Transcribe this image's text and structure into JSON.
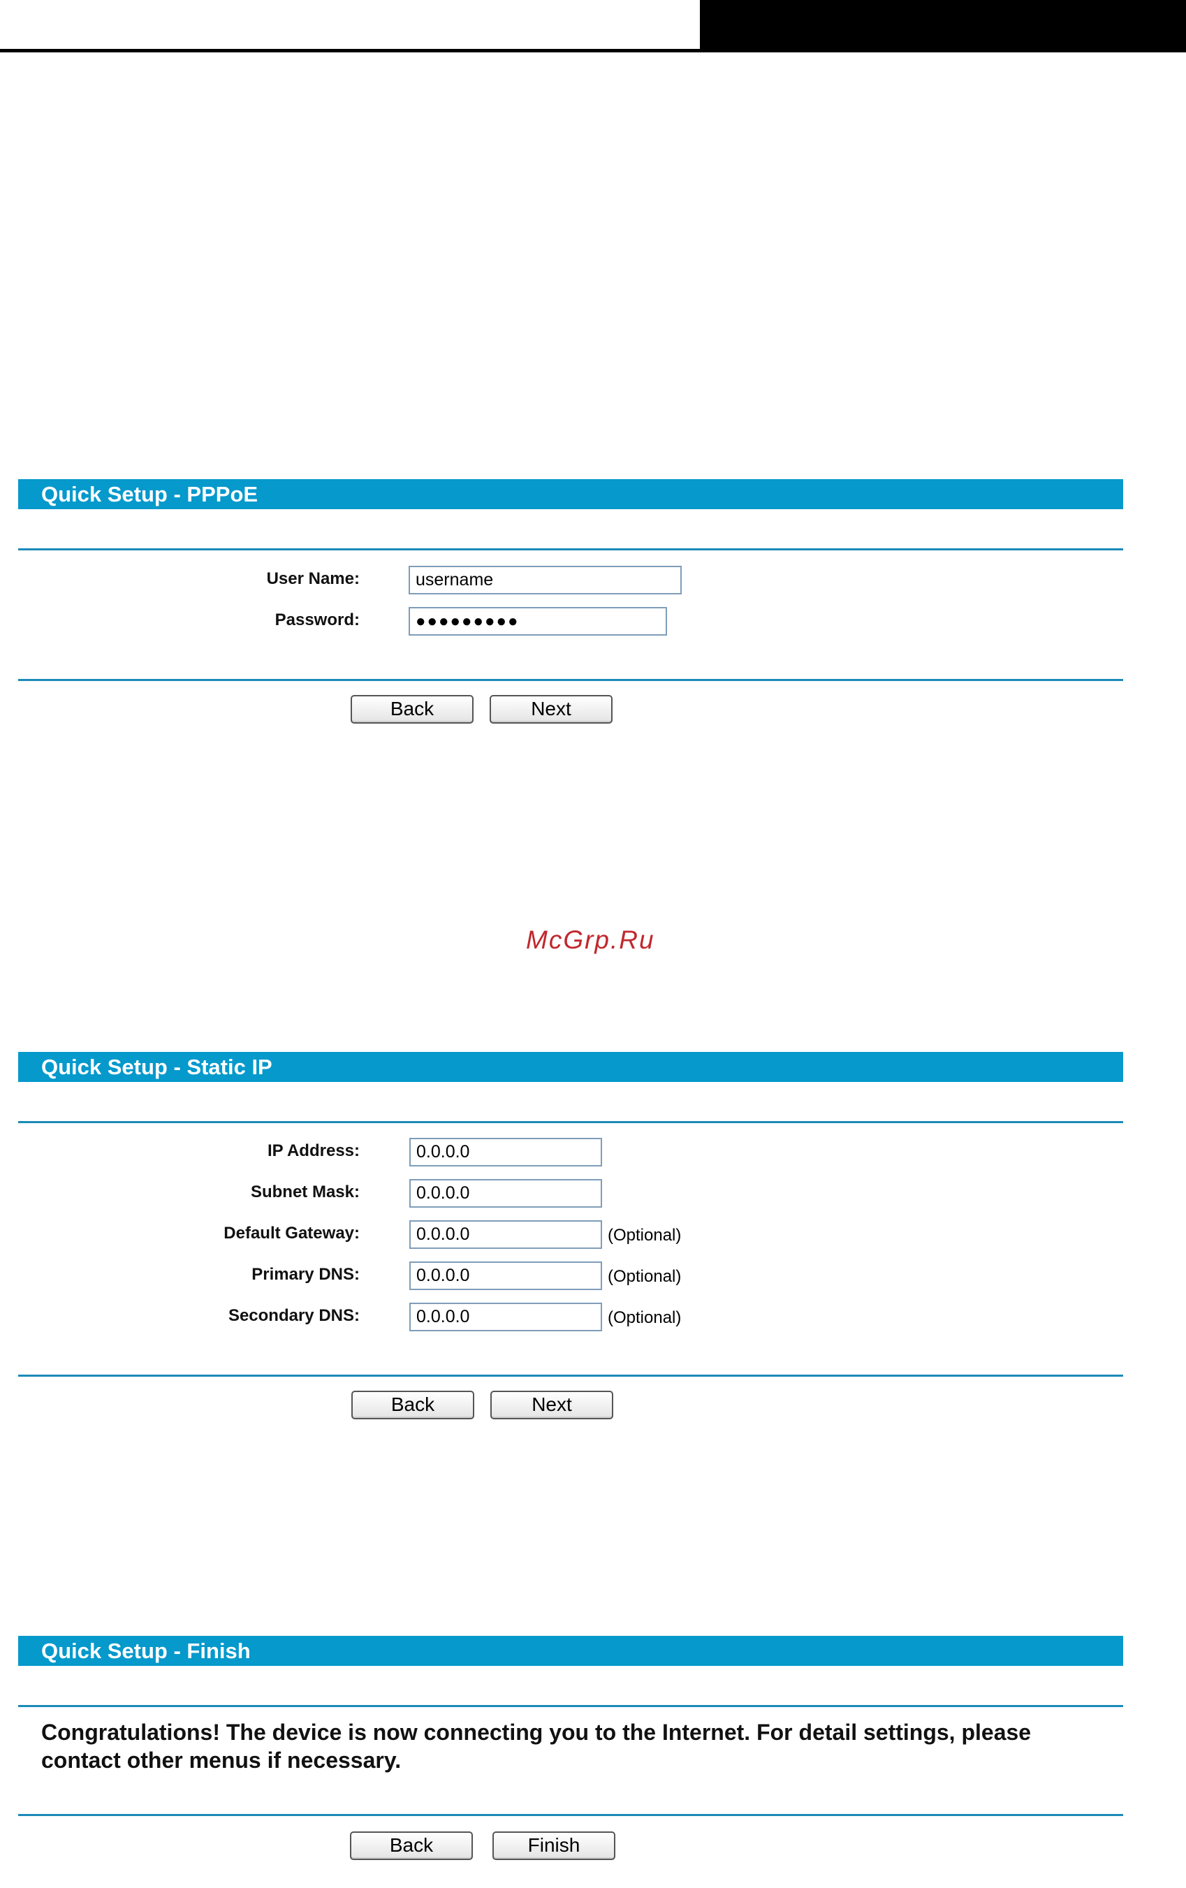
{
  "pppoe": {
    "title": "Quick Setup - PPPoE",
    "username_label": "User Name:",
    "username_value": "username",
    "password_label": "Password:",
    "password_value": "●●●●●●●●●",
    "back_label": "Back",
    "next_label": "Next"
  },
  "watermark": "McGrp.Ru",
  "static_ip": {
    "title": "Quick Setup - Static IP",
    "fields": [
      {
        "label": "IP Address:",
        "value": "0.0.0.0",
        "note": ""
      },
      {
        "label": "Subnet Mask:",
        "value": "0.0.0.0",
        "note": ""
      },
      {
        "label": "Default Gateway:",
        "value": "0.0.0.0",
        "note": "(Optional)"
      },
      {
        "label": "Primary DNS:",
        "value": "0.0.0.0",
        "note": "(Optional)"
      },
      {
        "label": "Secondary DNS:",
        "value": "0.0.0.0",
        "note": "(Optional)"
      }
    ],
    "back_label": "Back",
    "next_label": "Next"
  },
  "finish": {
    "title": "Quick Setup - Finish",
    "message": "Congratulations! The device is now connecting you to the Internet. For detail settings, please contact other menus if necessary.",
    "back_label": "Back",
    "finish_label": "Finish"
  }
}
